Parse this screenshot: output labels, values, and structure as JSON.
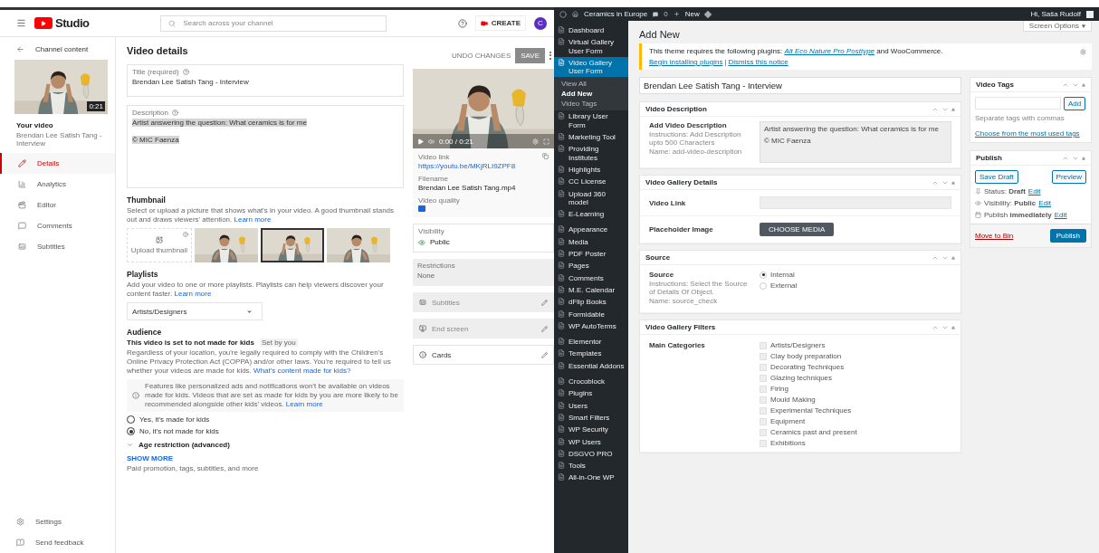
{
  "youtube": {
    "header": {
      "logo": "Studio",
      "search_placeholder": "Search across your channel",
      "create": "CREATE",
      "avatar": "C"
    },
    "sidebar": {
      "back": "Channel content",
      "duration": "0:21",
      "your_video": "Your video",
      "video_title": "Brendan Lee Satish Tang - Interview",
      "items": [
        {
          "label": "Details",
          "selected": true
        },
        {
          "label": "Analytics",
          "selected": false
        },
        {
          "label": "Editor",
          "selected": false
        },
        {
          "label": "Comments",
          "selected": false
        },
        {
          "label": "Subtitles",
          "selected": false
        }
      ],
      "footer": [
        "Settings",
        "Send feedback"
      ]
    },
    "details": {
      "title": "Video details",
      "undo": "UNDO CHANGES",
      "save": {
        "label": "SAVE",
        "disabled": true
      },
      "title_field": {
        "label": "Title (required)",
        "value": "Brendan Lee Satish Tang - Interview"
      },
      "description_field": {
        "label": "Description",
        "lines": [
          "Artist answering the question: What ceramics is for me",
          "© MIC Faenza"
        ],
        "selected": true
      },
      "thumbnail": {
        "heading": "Thumbnail",
        "text": "Select or upload a picture that shows what's in your video. A good thumbnail stands out and draws viewers' attention.",
        "link": "Learn more",
        "upload": "Upload thumbnail",
        "options": [
          {
            "selected": false
          },
          {
            "selected": true
          },
          {
            "selected": false
          }
        ]
      },
      "playlists": {
        "heading": "Playlists",
        "text": "Add your video to one or more playlists. Playlists can help viewers discover your content faster.",
        "link": "Learn more",
        "value": "Artists/Designers"
      },
      "audience": {
        "heading": "Audience",
        "status": "This video is set to not made for kids",
        "tag": "Set by you",
        "text": "Regardless of your location, you're legally required to comply with the Children's Online Privacy Protection Act (COPPA) and/or other laws. You're required to tell us whether your videos are made for kids.",
        "link": "What's content made for kids?",
        "info": "Features like personalized ads and notifications won't be available on videos made for kids. Videos that are set as made for kids by you are more likely to be recommended alongside other kids' videos.",
        "info_link": "Learn more",
        "options": [
          {
            "label": "Yes, it's made for kids",
            "selected": false
          },
          {
            "label": "No, it's not made for kids",
            "selected": true
          }
        ]
      },
      "age_restriction": {
        "label": "Age restriction (advanced)",
        "expanded": false
      },
      "show_more": "SHOW MORE",
      "more_text": "Paid promotion, tags, subtitles, and more"
    },
    "side": {
      "time": "0:00 / 0:21",
      "link_label": "Video link",
      "link": "https://youtu.be/MKjRLI9ZPF8",
      "filename_label": "Filename",
      "filename": "Brendan Lee Satish Tang.mp4",
      "quality_label": "Video quality",
      "visibility_label": "Visibility",
      "visibility": "Public",
      "restrictions_label": "Restrictions",
      "restrictions": "None",
      "rows": [
        {
          "label": "Subtitles",
          "disabled": true
        },
        {
          "label": "End screen",
          "disabled": true
        },
        {
          "label": "Cards",
          "disabled": false
        }
      ]
    }
  },
  "wordpress": {
    "admin_bar": {
      "site": "Ceramics in Europe",
      "comments": "0",
      "new": "New",
      "greeting": "Hi, Saša Rudolf"
    },
    "menu": [
      [
        {
          "label": "Dashboard",
          "selected": false
        },
        {
          "label": "Virtual Gallery User Form",
          "selected": false
        },
        {
          "label": "Video Gallery User Form",
          "selected": true,
          "children": [
            {
              "label": "View All",
              "selected": false
            },
            {
              "label": "Add New",
              "selected": true
            },
            {
              "label": "Video Tags",
              "selected": false
            }
          ]
        },
        {
          "label": "Library User Form",
          "selected": false
        },
        {
          "label": "Marketing Tool",
          "selected": false
        },
        {
          "label": "Providing Institutes",
          "selected": false
        },
        {
          "label": "Highlights",
          "selected": false
        },
        {
          "label": "CC License",
          "selected": false
        },
        {
          "label": "Upload 360 model",
          "selected": false
        },
        {
          "label": "E-Learning",
          "selected": false
        }
      ],
      [
        {
          "label": "Appearance",
          "selected": false
        },
        {
          "label": "Media",
          "selected": false
        },
        {
          "label": "PDF Poster",
          "selected": false
        },
        {
          "label": "Pages",
          "selected": false
        },
        {
          "label": "Comments",
          "selected": false
        },
        {
          "label": "M.E. Calendar",
          "selected": false
        },
        {
          "label": "dFlip Books",
          "selected": false
        },
        {
          "label": "Formidable",
          "selected": false
        },
        {
          "label": "WP AutoTerms",
          "selected": false
        }
      ],
      [
        {
          "label": "Elementor",
          "selected": false
        },
        {
          "label": "Templates",
          "selected": false
        },
        {
          "label": "Essential Addons",
          "selected": false
        }
      ],
      [
        {
          "label": "Crocoblock",
          "selected": false
        },
        {
          "label": "Plugins",
          "selected": false
        },
        {
          "label": "Users",
          "selected": false
        },
        {
          "label": "Smart Filters",
          "selected": false
        },
        {
          "label": "WP Security",
          "selected": false
        },
        {
          "label": "WP Users",
          "selected": false
        },
        {
          "label": "DSGVO PRO",
          "selected": false
        },
        {
          "label": "Tools",
          "selected": false
        },
        {
          "label": "All-in-One WP",
          "selected": false
        }
      ]
    ],
    "screen_options": "Screen Options",
    "heading": "Add New",
    "notice": {
      "before": "This theme requires the following plugins: ",
      "plugin": "Alt Eco Nature Pro Posttype",
      "after": " and WooCommerce.",
      "actions": [
        "Begin installing plugins",
        "Dismiss this notice"
      ],
      "separator": "|"
    },
    "title": "Brendan Lee Satish Tang - Interview",
    "boxes": [
      {
        "kind": "description",
        "title": "Video Description",
        "label": "Add Video Description",
        "instructions": "Instructions: Add Description upto 500 Characters",
        "name": "Name: add-video-description",
        "lines": [
          "Artist answering the question: What ceramics is for me",
          "© MIC Faenza"
        ]
      },
      {
        "kind": "details",
        "title": "Video Gallery Details",
        "fields": [
          {
            "kind": "input",
            "label": "Video Link"
          },
          {
            "kind": "media",
            "label": "Placeholder Image",
            "button": "CHOOSE MEDIA"
          }
        ]
      },
      {
        "kind": "source",
        "title": "Source",
        "label": "Source",
        "instructions": "Instructions: Select the Source of Details Of Object.",
        "name": "Name: source_check",
        "options": [
          {
            "label": "Internal",
            "selected": true
          },
          {
            "label": "External",
            "selected": false
          }
        ]
      },
      {
        "kind": "filters",
        "title": "Video Gallery Filters",
        "label": "Main Categories",
        "options": [
          {
            "label": "Artists/Designers",
            "checked": false
          },
          {
            "label": "Clay body preparation",
            "checked": false
          },
          {
            "label": "Decorating Techniques",
            "checked": false
          },
          {
            "label": "Glazing techniques",
            "checked": false
          },
          {
            "label": "Firing",
            "checked": false
          },
          {
            "label": "Mould Making",
            "checked": false
          },
          {
            "label": "Experimental Techniques",
            "checked": false
          },
          {
            "label": "Equipment",
            "checked": false
          },
          {
            "label": "Ceramics past and present",
            "checked": false
          },
          {
            "label": "Exhibitions",
            "checked": false
          }
        ]
      }
    ],
    "tags_box": {
      "title": "Video Tags",
      "add": "Add",
      "hint": "Separate tags with commas",
      "link": "Choose from the most used tags"
    },
    "publish_box": {
      "title": "Publish",
      "save_draft": "Save Draft",
      "preview": "Preview",
      "rows": [
        {
          "text": "Status: **Draft**",
          "link": "Edit"
        },
        {
          "text": "Visibility: **Public**",
          "link": "Edit"
        },
        {
          "text": "Publish **immediately**",
          "link": "Edit"
        }
      ],
      "trash": "Move to Bin",
      "publish": "Publish"
    }
  }
}
